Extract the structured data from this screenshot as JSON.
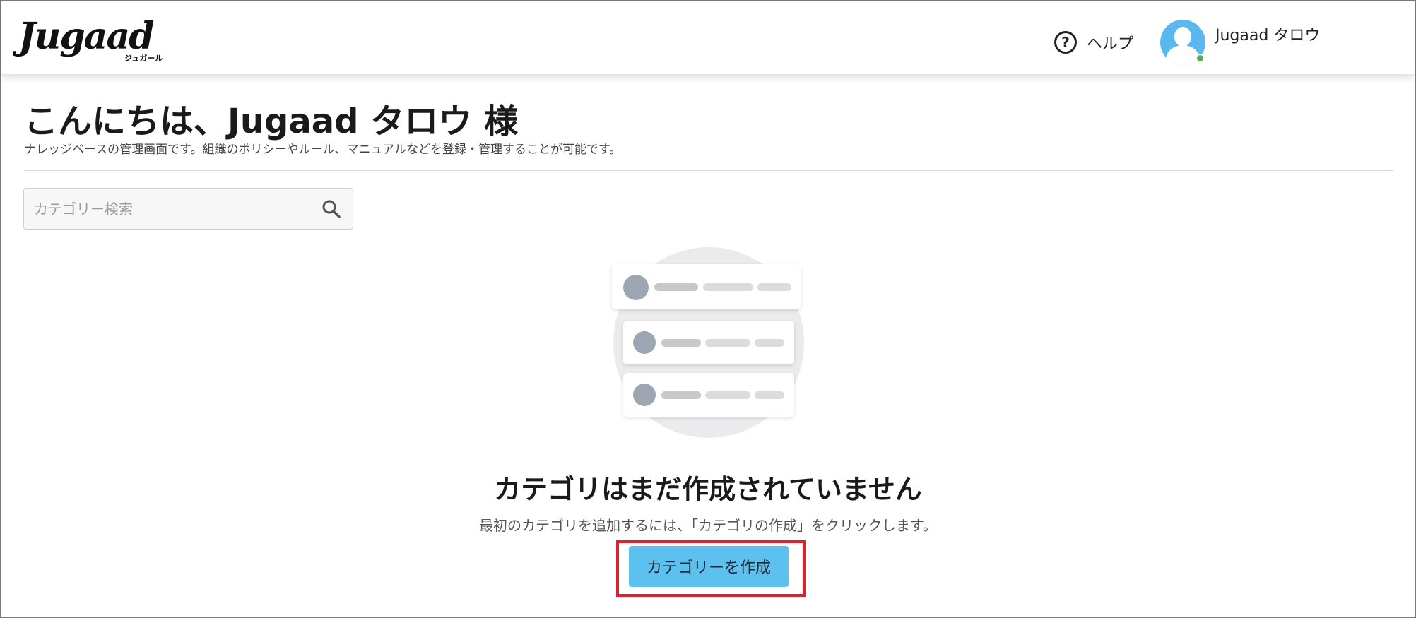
{
  "header": {
    "logo_text": "Jugaad",
    "logo_sub": "ジュガール",
    "help_label": "ヘルプ",
    "help_icon": "question-circle-icon",
    "user_name": "Jugaad タロウ",
    "avatar_icon": "user-avatar-icon",
    "status_color": "#4caf50"
  },
  "main": {
    "greeting": "こんにちは、Jugaad タロウ 様",
    "subtitle": "ナレッジベースの管理画面です。組織のポリシーやルール、マニュアルなどを登録・管理することが可能です。",
    "search": {
      "placeholder": "カテゴリー検索",
      "value": "",
      "icon": "search-icon"
    },
    "empty_state": {
      "title": "カテゴリはまだ作成されていません",
      "description": "最初のカテゴリを追加するには、「カテゴリの作成」をクリックします。",
      "button_label": "カテゴリーを作成",
      "illustration": "empty-list-illustration"
    }
  },
  "colors": {
    "accent": "#5cc1ef",
    "highlight_border": "#e0202a",
    "avatar_bg": "#5bb8ee"
  }
}
